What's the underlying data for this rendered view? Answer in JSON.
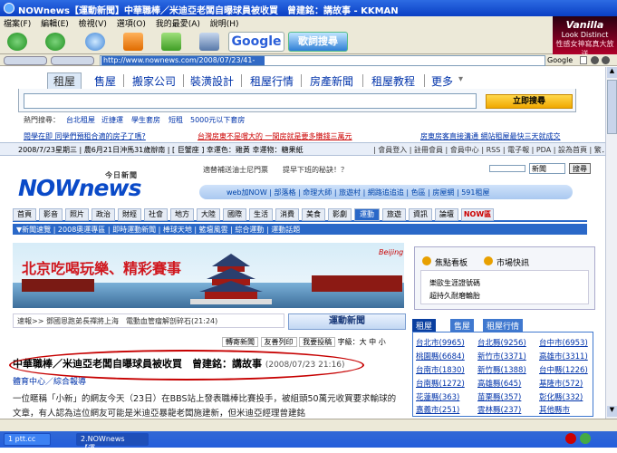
{
  "window": {
    "title": "NOWnews【運動新聞】中華職棒／米迪亞老闆自曝球員被收買　曾建銘：講故事 - KKMAN"
  },
  "menu": [
    "編輯(E)",
    "檢視(V)",
    "選項(O)",
    "我的最愛(A)",
    "說明(H)"
  ],
  "menu_first": "檔案(F)",
  "toolbar": {
    "google_label": "Google",
    "lyric_label": "歌詞搜尋"
  },
  "ad": {
    "brand": "Vanilla",
    "sub": "Look Distinct",
    "caption": "性感女神寫真大放送"
  },
  "address": {
    "url": "http://www.nownews.com/2008/07/23/41-2309168.htm",
    "google": "Google"
  },
  "site_tabs": [
    "租屋",
    "售屋",
    "搬家公司",
    "裝潢設計",
    "租屋行情",
    "房產新聞",
    "租屋教程",
    "更多"
  ],
  "search": {
    "button": "立即搜尋"
  },
  "hot_search": {
    "label": "熱門搜尋：",
    "items": [
      "台北租屋",
      "近捷運",
      "學生套房",
      "短租",
      "5000元以下套房"
    ]
  },
  "promo": [
    "閱學在即 同學們預租合適的房子了嗎?",
    "台灣房東不是嚐大的 一間房就是要多賺錢三萬元",
    "房東房客直接溝通 網站租屋最快三天就成交"
  ],
  "datebar": {
    "text": "2008/7/23星期三 | 農6月21日沖馬31歲辦南 | [ 巨蟹座 ] 幸運色：雞黃 幸運物：糖果紙",
    "right": "| 會員登入 | 註冊會員 | 會員中心 | RSS | 電子報 | PDA | 設為首頁 | 繁．簡"
  },
  "logo": {
    "text": "NOWnews",
    "sub": "今日新聞"
  },
  "tagline": "適替補送油士尼門票　　提早下班的秘訣！？",
  "search_small": {
    "select": "新聞",
    "button": "搜尋"
  },
  "links_bar": "web加NOW  |  部落格  |  命理大師  |  旅遊村  |  網路追追追  |  色區  |  房屋網  |  591租屋",
  "nav": [
    "首頁",
    "影音",
    "照片",
    "政治",
    "財經",
    "社會",
    "地方",
    "大陸",
    "國際",
    "生活",
    "消費",
    "美食",
    "影劇",
    "運動",
    "旅遊",
    "資訊",
    "論壇",
    "NOW區"
  ],
  "subnav": "▼新聞速覽 | 2008奧運專區 | 即時運動新聞 | 棒球天地 | 籃壇風雲 | 綜合運動 | 運動話題",
  "banner": {
    "text": "北京吃喝玩樂、精彩賽事",
    "beijing": "Beijing"
  },
  "sidebox": {
    "items": [
      "焦點看板",
      "市場快訊"
    ],
    "lines": [
      "樂歐生涯證號碼",
      "超持久耐磨輪胎"
    ]
  },
  "news_strip": "速報>> 鄧國恩跑弟長禪將上海　電動血管瘤解剖碎石(21:24)",
  "sports_button": "運動新聞",
  "tools": [
    "轉寄新聞",
    "友善列印",
    "我要投稿",
    "字級：大 中 小"
  ],
  "headline": {
    "text": "中華職棒／米迪亞老闆自曝球員被收買　曾建銘：講故事",
    "timestamp": "(2008/07/23 21:16)"
  },
  "category": "體育中心／綜合報導",
  "body": "一位暱稱「小新」的網友今天（23日）在BBS站上發表職棒比賽投手，被組頭50萬元收買要求輸球的文章，有人認為這位網友可能是米迪亞暴龍老闆施建新，但米迪亞經理曾建銘",
  "region_tabs": [
    "租屋",
    "售屋",
    "租屋行情"
  ],
  "regions": [
    [
      "台北市(9965)",
      "台北縣(9256)",
      "台中市(6953)"
    ],
    [
      "桃園縣(6684)",
      "新竹市(3371)",
      "高雄市(3311)"
    ],
    [
      "台南市(1830)",
      "新竹縣(1388)",
      "台中縣(1226)"
    ],
    [
      "台南縣(1272)",
      "高雄縣(645)",
      "基隆市(572)"
    ],
    [
      "花蓮縣(363)",
      "苗栗縣(357)",
      "彰化縣(332)"
    ],
    [
      "嘉義市(251)",
      "雲林縣(237)",
      "其他縣市"
    ]
  ],
  "taskbar": {
    "items": [
      "1 ptt.cc",
      "2.NOWnews【運..."
    ]
  }
}
